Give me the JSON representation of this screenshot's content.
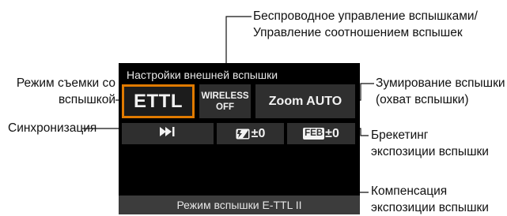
{
  "callouts": {
    "wireless": [
      "Беспроводное управление вспышками/",
      "Управление соотношением вспышек"
    ],
    "mode": [
      "Режим съемки со",
      "вспышкой"
    ],
    "sync": "Синхронизация",
    "zoom": [
      "Зумирование вспышки",
      "(охват вспышки)"
    ],
    "feb": [
      "Брекетинг",
      "экспозиции вспышки"
    ],
    "comp": [
      "Компенсация",
      "экспозиции вспышки"
    ]
  },
  "screen": {
    "title": "Настройки внешней вспышки",
    "ettl": "ETTL",
    "wireless": [
      "WIRELESS",
      "OFF"
    ],
    "zoom": "Zoom AUTO",
    "comp_value": "±0",
    "feb_badge": "FEB",
    "feb_value": "±0",
    "bottom": "Режим вспышки E-TTL II"
  },
  "colors": {
    "highlight": "#e07a00",
    "cell": "#2f2f2f",
    "screen": "#000000"
  },
  "icons": [
    "high-speed-sync-icon",
    "flash-exposure-compensation-icon"
  ]
}
